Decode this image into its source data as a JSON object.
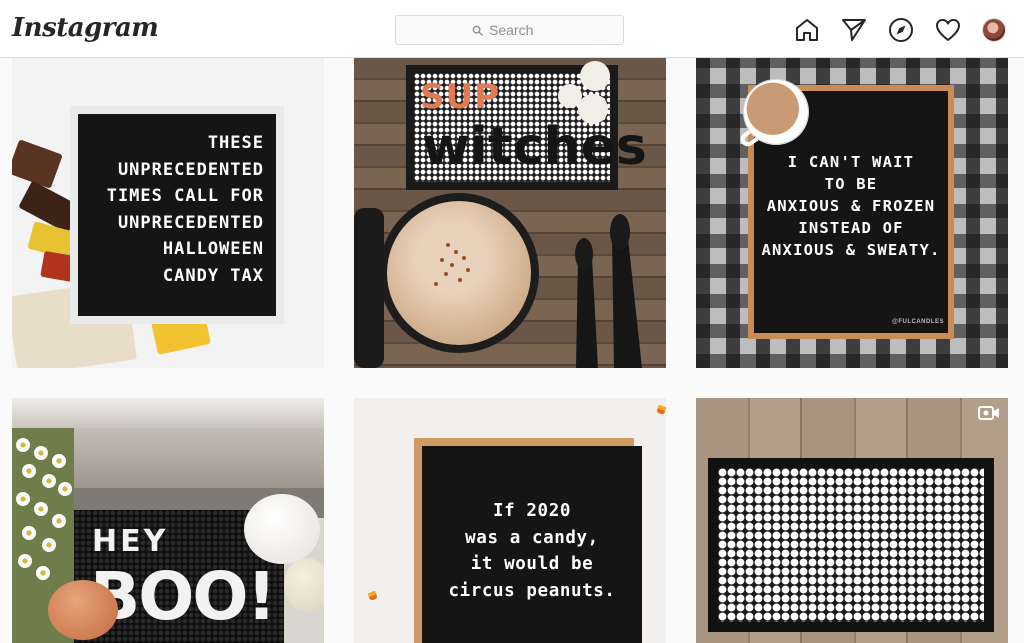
{
  "app": {
    "logo_text": "Instagram"
  },
  "search": {
    "placeholder": "Search"
  },
  "nav": {
    "icons": [
      "home-icon",
      "direct-send-icon",
      "explore-compass-icon",
      "activity-heart-icon",
      "profile-avatar"
    ]
  },
  "posts": [
    {
      "type": "image",
      "board_lines": [
        "THESE",
        "UNPRECEDENTED",
        "TIMES CALL FOR",
        "UNPRECEDENTED",
        "HALLOWEEN",
        "CANDY TAX"
      ]
    },
    {
      "type": "image",
      "mat_line1": "SUP",
      "mat_line2": "witches"
    },
    {
      "type": "image",
      "board_lines": [
        "I CAN'T WAIT",
        "TO BE",
        "ANXIOUS & FROZEN",
        "INSTEAD OF",
        "ANXIOUS & SWEATY."
      ],
      "credit": "@FULCANDLES"
    },
    {
      "type": "image",
      "mat_line1": "HEY",
      "mat_line2": "BOO!"
    },
    {
      "type": "image",
      "board_lines": [
        "If 2020",
        "was a candy,",
        "it would be",
        "circus peanuts."
      ]
    },
    {
      "type": "video",
      "badge_icon": "video-camera-icon"
    }
  ],
  "colors": {
    "accent_orange": "#e07a55",
    "border": "#dbdbdb",
    "text": "#262626"
  }
}
